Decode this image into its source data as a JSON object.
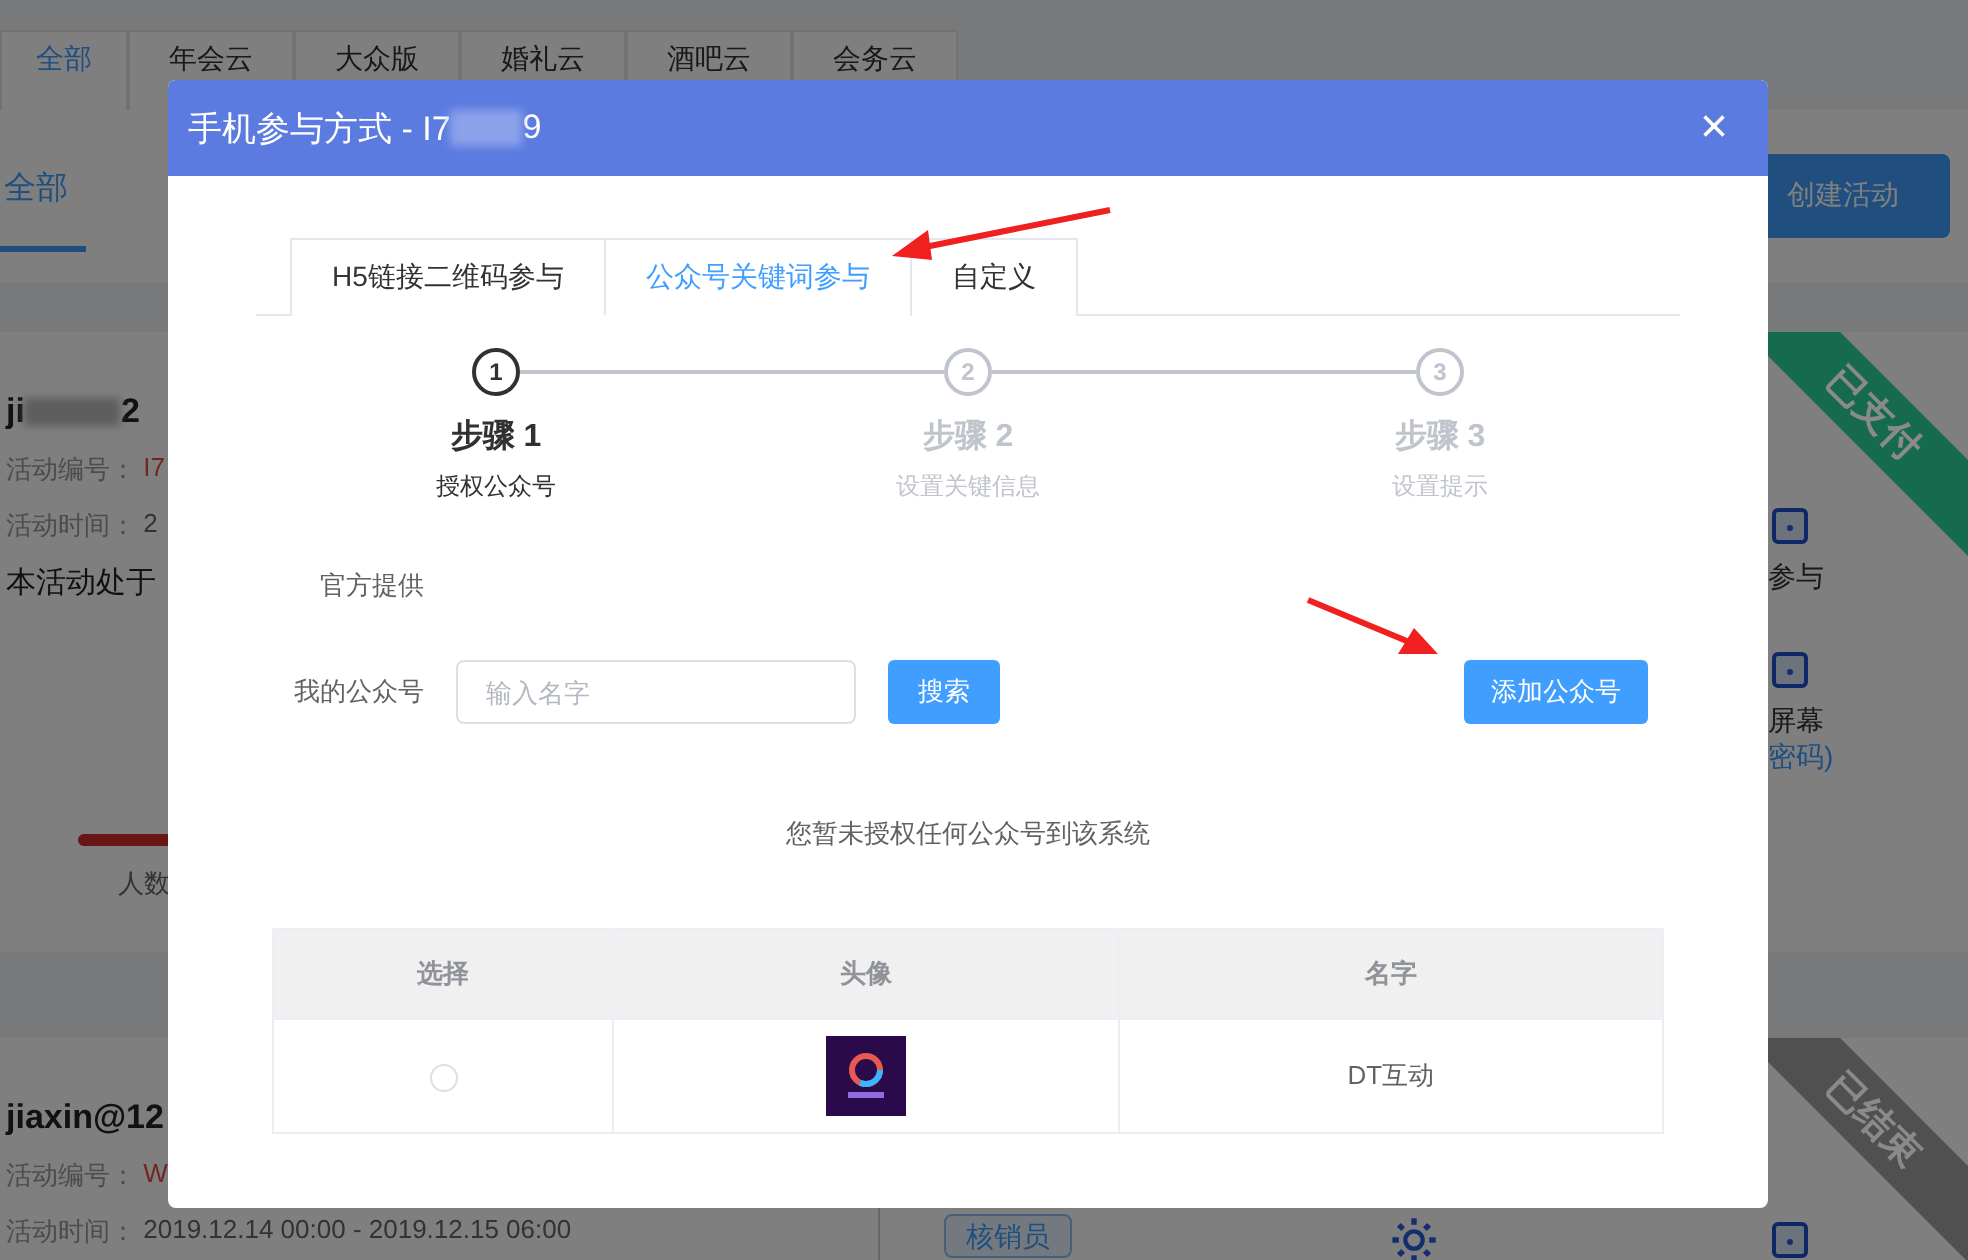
{
  "category_tabs": [
    {
      "label": "全部",
      "selected": true
    },
    {
      "label": "年会云",
      "selected": false
    },
    {
      "label": "大众版",
      "selected": false
    },
    {
      "label": "婚礼云",
      "selected": false
    },
    {
      "label": "酒吧云",
      "selected": false
    },
    {
      "label": "会务云",
      "selected": false
    }
  ],
  "sub_tab": {
    "label": "全部",
    "selected": true
  },
  "create_button": "创建活动",
  "activity_cards": [
    {
      "account_start": "ji",
      "account_end": "2",
      "number_label": "活动编号：",
      "number": "I7",
      "time_label": "活动时间：",
      "time": "2",
      "status_text": "本活动处于",
      "progress": {
        "level": 0.35,
        "label": "人数"
      },
      "ribbon": {
        "label": "已支付",
        "color": "#166b4f"
      },
      "side_items": [
        {
          "label": "参与"
        },
        {
          "label": "屏幕",
          "link": "密码)"
        }
      ]
    },
    {
      "account_start": "jiaxin@12",
      "number_label": "活动编号：",
      "number": "W",
      "time_label": "活动时间：",
      "time": "2019.12.14 00:00 - 2019.12.15 06:00",
      "ribbon": {
        "label": "已结束",
        "color": "#505050"
      },
      "action_button": "核销员"
    }
  ],
  "modal": {
    "title_prefix": "手机参与方式 - I7",
    "title_suffix": "9",
    "close": "×",
    "tabs": [
      {
        "label": "H5链接二维码参与",
        "selected": false
      },
      {
        "label": "公众号关键词参与",
        "selected": true
      },
      {
        "label": "自定义",
        "selected": false
      }
    ],
    "steps": [
      {
        "number": "1",
        "title": "步骤 1",
        "description": "授权公众号",
        "active": true
      },
      {
        "number": "2",
        "title": "步骤 2",
        "description": "设置关键信息",
        "active": false
      },
      {
        "number": "3",
        "title": "步骤 3",
        "description": "设置提示",
        "active": false
      }
    ],
    "official_label": "官方提供",
    "account_label": "我的公众号",
    "search_placeholder": "输入名字",
    "search_button": "搜索",
    "add_button": "添加公众号",
    "empty_message": "您暂未授权任何公众号到该系统",
    "table": {
      "columns": [
        "选择",
        "头像",
        "名字"
      ],
      "rows": [
        {
          "selected": false,
          "name": "DT互动"
        }
      ]
    }
  }
}
